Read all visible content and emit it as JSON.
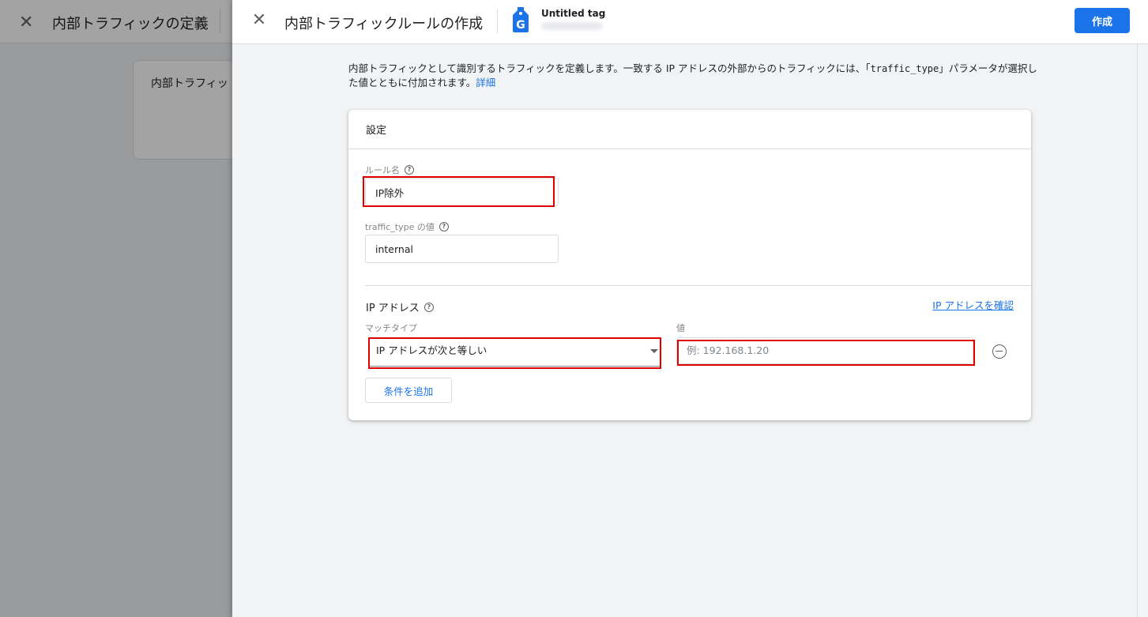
{
  "background": {
    "title": "内部トラフィックの定義",
    "card_title": "内部トラフィッ"
  },
  "header": {
    "title": "内部トラフィックルールの作成",
    "tag_name": "Untitled tag",
    "create_label": "作成"
  },
  "description": {
    "text_before_code": "内部トラフィックとして識別するトラフィックを定義します。一致する IP アドレスの外部からのトラフィックには、「",
    "code": "traffic_type",
    "text_after_code": "」パラメータが選択した値とともに付加されます。",
    "link": "詳細"
  },
  "card": {
    "title": "設定",
    "rule_name_label": "ルール名",
    "rule_name_value": "IP除外",
    "traffic_type_label": "traffic_type の値",
    "traffic_type_value": "internal",
    "ip_section_title": "IP アドレス",
    "ip_check_link": "IP アドレスを確認",
    "match_type_label": "マッチタイプ",
    "match_type_value": "IP アドレスが次と等しい",
    "value_label": "値",
    "value_placeholder": "例: 192.168.1.20",
    "add_condition_label": "条件を追加"
  },
  "colors": {
    "primary": "#1a73e8",
    "highlight": "#e00000"
  },
  "icons": [
    "close-icon",
    "tag-icon",
    "help-icon",
    "chevron-down-icon",
    "remove-circle-icon"
  ]
}
